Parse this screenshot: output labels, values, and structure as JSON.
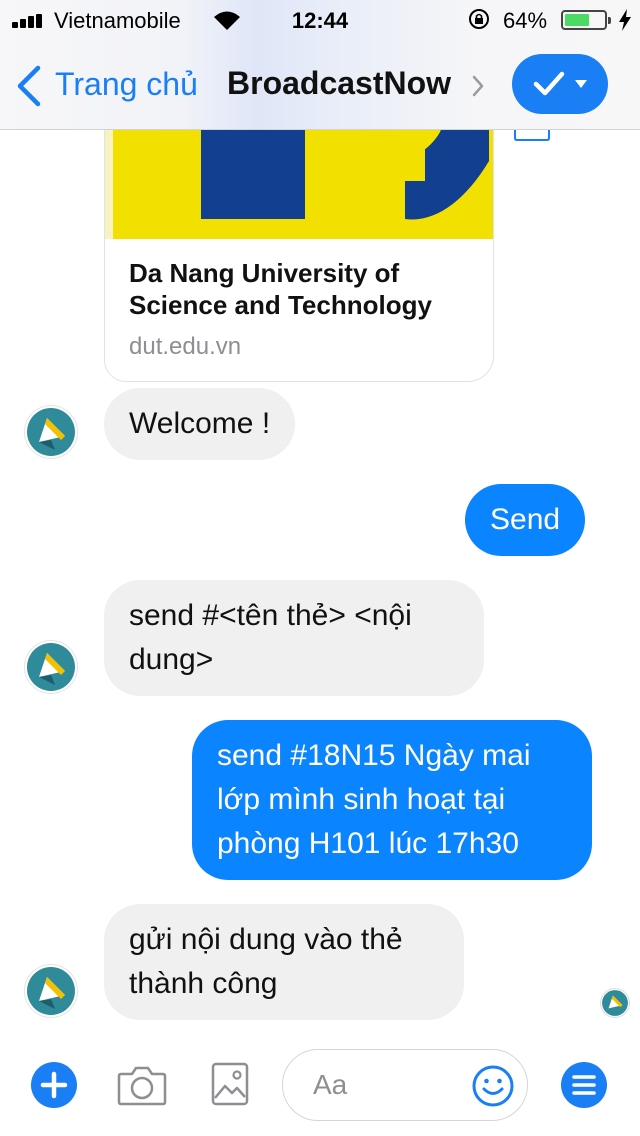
{
  "status_bar": {
    "carrier": "Vietnamobile",
    "time": "12:44",
    "battery_percent": "64%",
    "battery_level": 0.64,
    "icons": [
      "signal-icon",
      "wifi-icon",
      "rotation-lock-icon",
      "battery-icon",
      "charging-bolt-icon"
    ]
  },
  "nav": {
    "back_label": "Trang chủ",
    "title": "BroadcastNow"
  },
  "link_preview": {
    "title": "Da Nang University of Science and Technology",
    "domain": "dut.edu.vn"
  },
  "messages": [
    {
      "from": "bot",
      "text": "Welcome !"
    },
    {
      "from": "user",
      "text": "Send"
    },
    {
      "from": "bot",
      "text": "send #<tên thẻ> <nội\ndung>"
    },
    {
      "from": "user",
      "text": "send #18N15 Ngày mai\nlớp mình sinh hoạt tại\nphòng H101 lúc 17h30"
    },
    {
      "from": "bot",
      "text": "gửi nội dung vào thẻ\nthành công"
    }
  ],
  "composer": {
    "placeholder": "Aa"
  },
  "colors": {
    "accent": "#1a7ef5",
    "outgoing_bubble": "#0a84ff",
    "incoming_bubble": "#f1f0f0",
    "battery": "#4cd964"
  }
}
